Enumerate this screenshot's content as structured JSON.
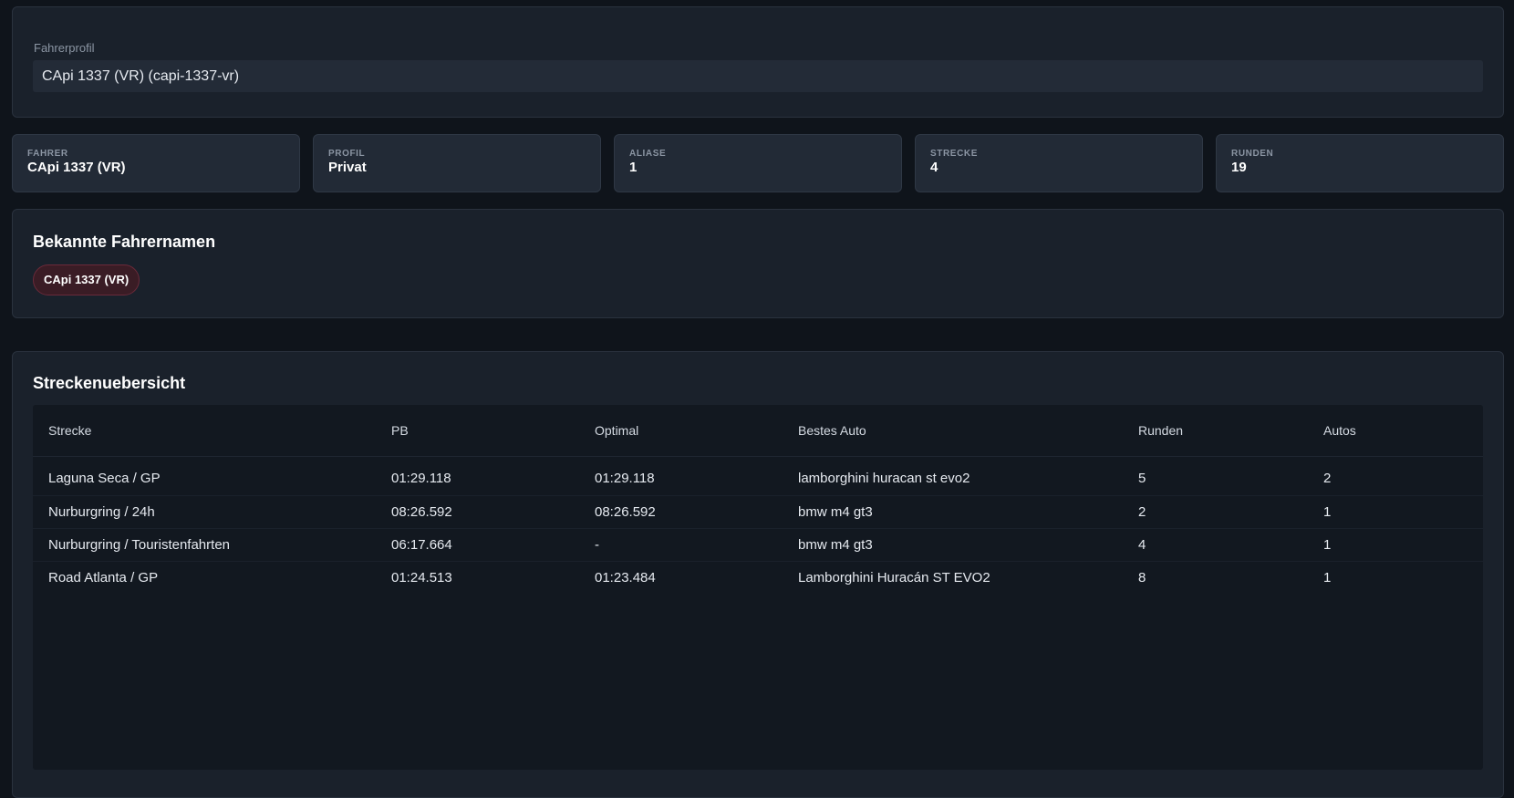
{
  "profile": {
    "label": "Fahrerprofil",
    "selected": "CApi 1337 (VR) (capi-1337-vr)"
  },
  "stats": {
    "fahrer": {
      "label": "FAHRER",
      "value": "CApi 1337 (VR)"
    },
    "profil": {
      "label": "PROFIL",
      "value": "Privat"
    },
    "aliase": {
      "label": "ALIASE",
      "value": "1"
    },
    "strecke": {
      "label": "STRECKE",
      "value": "4"
    },
    "runden": {
      "label": "RUNDEN",
      "value": "19"
    }
  },
  "aliases": {
    "title": "Bekannte Fahrernamen",
    "items": [
      "CApi 1337 (VR)"
    ]
  },
  "tracks": {
    "title": "Streckenuebersicht",
    "columns": [
      "Strecke",
      "PB",
      "Optimal",
      "Bestes Auto",
      "Runden",
      "Autos"
    ],
    "rows": [
      [
        "Laguna Seca / GP",
        "01:29.118",
        "01:29.118",
        "lamborghini huracan st evo2",
        "5",
        "2"
      ],
      [
        "Nurburgring / 24h",
        "08:26.592",
        "08:26.592",
        "bmw m4 gt3",
        "2",
        "1"
      ],
      [
        "Nurburgring / Touristenfahrten",
        "06:17.664",
        "-",
        "bmw m4 gt3",
        "4",
        "1"
      ],
      [
        "Road Atlanta / GP",
        "01:24.513",
        "01:23.484",
        "Lamborghini Huracán ST EVO2",
        "8",
        "1"
      ]
    ]
  }
}
